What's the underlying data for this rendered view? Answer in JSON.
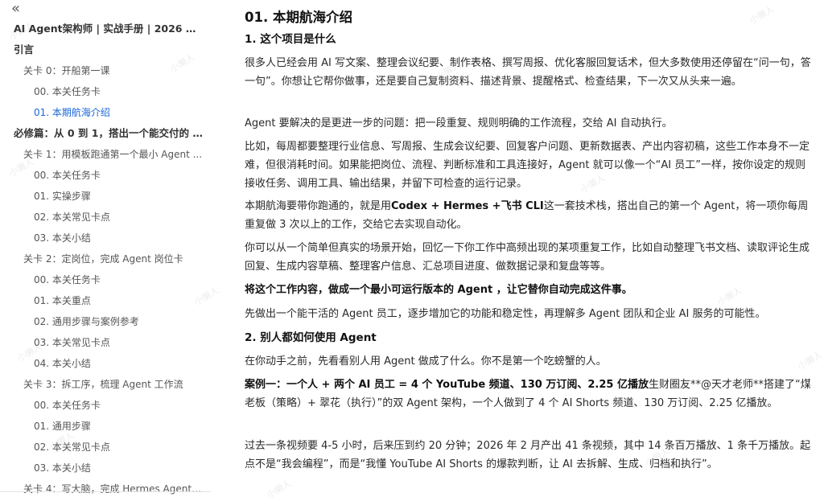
{
  "sidebar": {
    "collapse_glyph": "«",
    "items": [
      {
        "label": "AI Agent架构师 | 实战手册 | 2026 年 ...",
        "level": 0,
        "active": false
      },
      {
        "label": "引言",
        "level": 0,
        "active": false
      },
      {
        "label": "关卡 0：开船第一课",
        "level": 1,
        "active": false
      },
      {
        "label": "00. 本关任务卡",
        "level": 2,
        "active": false
      },
      {
        "label": "01. 本期航海介绍",
        "level": 2,
        "active": true
      },
      {
        "label": "必修篇：从 0 到 1，搭出一个能交付的 ...",
        "level": 0,
        "active": false
      },
      {
        "label": "关卡 1：用模板跑通第一个最小 Agent ...",
        "level": 1,
        "active": false
      },
      {
        "label": "00. 本关任务卡",
        "level": 2,
        "active": false
      },
      {
        "label": "01. 实操步骤",
        "level": 2,
        "active": false
      },
      {
        "label": "02. 本关常见卡点",
        "level": 2,
        "active": false
      },
      {
        "label": "03. 本关小结",
        "level": 2,
        "active": false
      },
      {
        "label": "关卡 2：定岗位，完成 Agent 岗位卡",
        "level": 1,
        "active": false
      },
      {
        "label": "00. 本关任务卡",
        "level": 2,
        "active": false
      },
      {
        "label": "01. 本关重点",
        "level": 2,
        "active": false
      },
      {
        "label": "02. 通用步骤与案例参考",
        "level": 2,
        "active": false
      },
      {
        "label": "03. 本关常见卡点",
        "level": 2,
        "active": false
      },
      {
        "label": "04. 本关小结",
        "level": 2,
        "active": false
      },
      {
        "label": "关卡 3：拆工序，梳理 Agent 工作流",
        "level": 1,
        "active": false
      },
      {
        "label": "00. 本关任务卡",
        "level": 2,
        "active": false
      },
      {
        "label": "01. 通用步骤",
        "level": 2,
        "active": false
      },
      {
        "label": "02. 本关常见卡点",
        "level": 2,
        "active": false
      },
      {
        "label": "03. 本关小结",
        "level": 2,
        "active": false
      },
      {
        "label": "关卡 4：写大脑，完成 Hermes Agent ...",
        "level": 1,
        "active": false
      }
    ]
  },
  "article": {
    "title": "01. 本期航海介绍",
    "s1_heading": "1. 这个项目是什么",
    "p1": "很多人已经会用 AI 写文案、整理会议纪要、制作表格、撰写周报、优化客服回复话术，但大多数使用还停留在“问一句，答一句”。你想让它帮你做事，还是要自己复制资料、描述背景、提醒格式、检查结果，下一次又从头来一遍。",
    "p2": "Agent 要解决的是更进一步的问题：把一段重复、规则明确的工作流程，交给 AI 自动执行。",
    "p3": "比如，每周都要整理行业信息、写周报、生成会议纪要、回复客户问题、更新数据表、产出内容初稿，这些工作本身不一定难，但很消耗时间。如果能把岗位、流程、判断标准和工具连接好，Agent 就可以像一个“AI 员工”一样，按你设定的规则接收任务、调用工具、输出结果，并留下可检查的运行记录。",
    "p4_pre": "本期航海要带你跑通的，就是用",
    "p4_bold": "Codex + Hermes +飞书 CLI",
    "p4_post": "这一套技术栈，搭出自己的第一个 Agent，将一项你每周重复做 3 次以上的工作，交给它去实现自动化。",
    "p5": "你可以从一个简单但真实的场景开始，回忆一下你工作中高频出现的某项重复工作，比如自动整理飞书文档、读取评论生成回复、生成内容草稿、整理客户信息、汇总项目进度、做数据记录和复盘等等。",
    "p6": "将这个工作内容，做成一个最小可运行版本的 Agent ，让它替你自动完成这件事。",
    "p7": "先做出一个能干活的 Agent 员工，逐步增加它的功能和稳定性，再理解多 Agent 团队和企业 AI 服务的可能性。",
    "s2_heading": "2. 别人都如何使用 Agent",
    "p8": "在你动手之前，先看看别人用 Agent 做成了什么。你不是第一个吃螃蟹的人。",
    "p9_bold": "案例一：一个人 + 两个 AI 员工 = 4 个 YouTube 频道、130 万订阅、2.25 亿播放",
    "p9_post": "生财圈友**@天才老师**搭建了“煤老板（策略）+ 翠花（执行）”的双 Agent 架构，一个人做到了 4 个 AI Shorts 频道、130 万订阅、2.25 亿播放。",
    "p10": "过去一条视频要 4-5 小时，后来压到约 20 分钟；2026 年 2 月产出 41 条视频，其中 14 条百万播放、1 条千万播放。起点不是“我会编程”，而是“我懂 YouTube AI Shorts 的爆款判断，让 AI 去拆解、生成、归档和执行”。"
  },
  "watermark": "小懒人",
  "colors": {
    "active": "#1a66d9",
    "text": "#2a2a2a"
  }
}
